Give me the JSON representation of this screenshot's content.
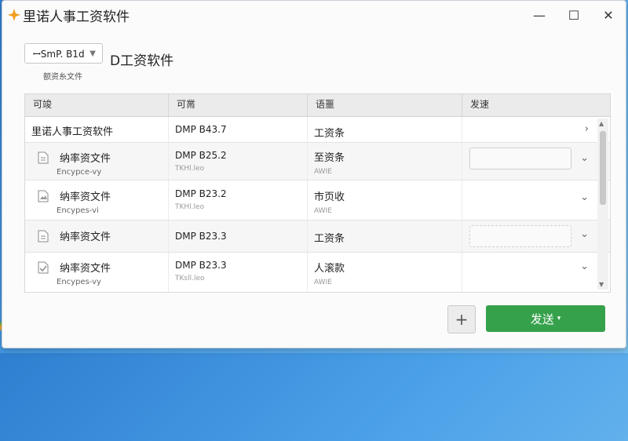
{
  "window": {
    "title": "里诺人事工资软件",
    "controls": [
      "—",
      "☐",
      "✕"
    ]
  },
  "toolbar": {
    "select_value": "ꟷSmP. B1d",
    "select_hint": "额资糸文件",
    "page_title": "D工资软件"
  },
  "table": {
    "headers": [
      "可竣",
      "可黹",
      "语噩",
      "发速"
    ],
    "rows": [
      {
        "name": "里诺人事工资软件",
        "icon": "",
        "sub": "",
        "val": "DMP B43.7",
        "val_sub": "",
        "status": "工资条",
        "status_sub": "",
        "send_field": "none",
        "chevron": "right"
      },
      {
        "name": "纳率资文件",
        "icon": "document-icon",
        "sub": "Encypce-vy",
        "val": "DMP B25.2",
        "val_sub": "TKHl.leo",
        "status": "至资条",
        "status_sub": "AWIE",
        "send_field": "solid",
        "chevron": "down"
      },
      {
        "name": "纳率资文件",
        "icon": "image-document-icon",
        "sub": "Encypes-vi",
        "val": "DMP B23.2",
        "val_sub": "TKHl.leo",
        "status": "市页收",
        "status_sub": "AWIE",
        "send_field": "none",
        "chevron": "down"
      },
      {
        "name": "纳率资文件",
        "icon": "document-icon",
        "sub": "",
        "val": "DMP B23.3",
        "val_sub": "",
        "status": "工资条",
        "status_sub": "",
        "send_field": "dashed",
        "chevron": "down"
      },
      {
        "name": "纳率资文件",
        "icon": "checked-document-icon",
        "sub": "Encypes-vy",
        "val": "DMP B23.3",
        "val_sub": "TKsll.leo",
        "status": "人滚款",
        "status_sub": "AWIE",
        "send_field": "none",
        "chevron": "down"
      }
    ]
  },
  "actions": {
    "add_label": "+",
    "send_label": "发送",
    "send_caret": "▾"
  },
  "colors": {
    "accent_green": "#35a14b",
    "header_bg": "#ebebeb",
    "desktop_blue": "#2f7fd0"
  }
}
